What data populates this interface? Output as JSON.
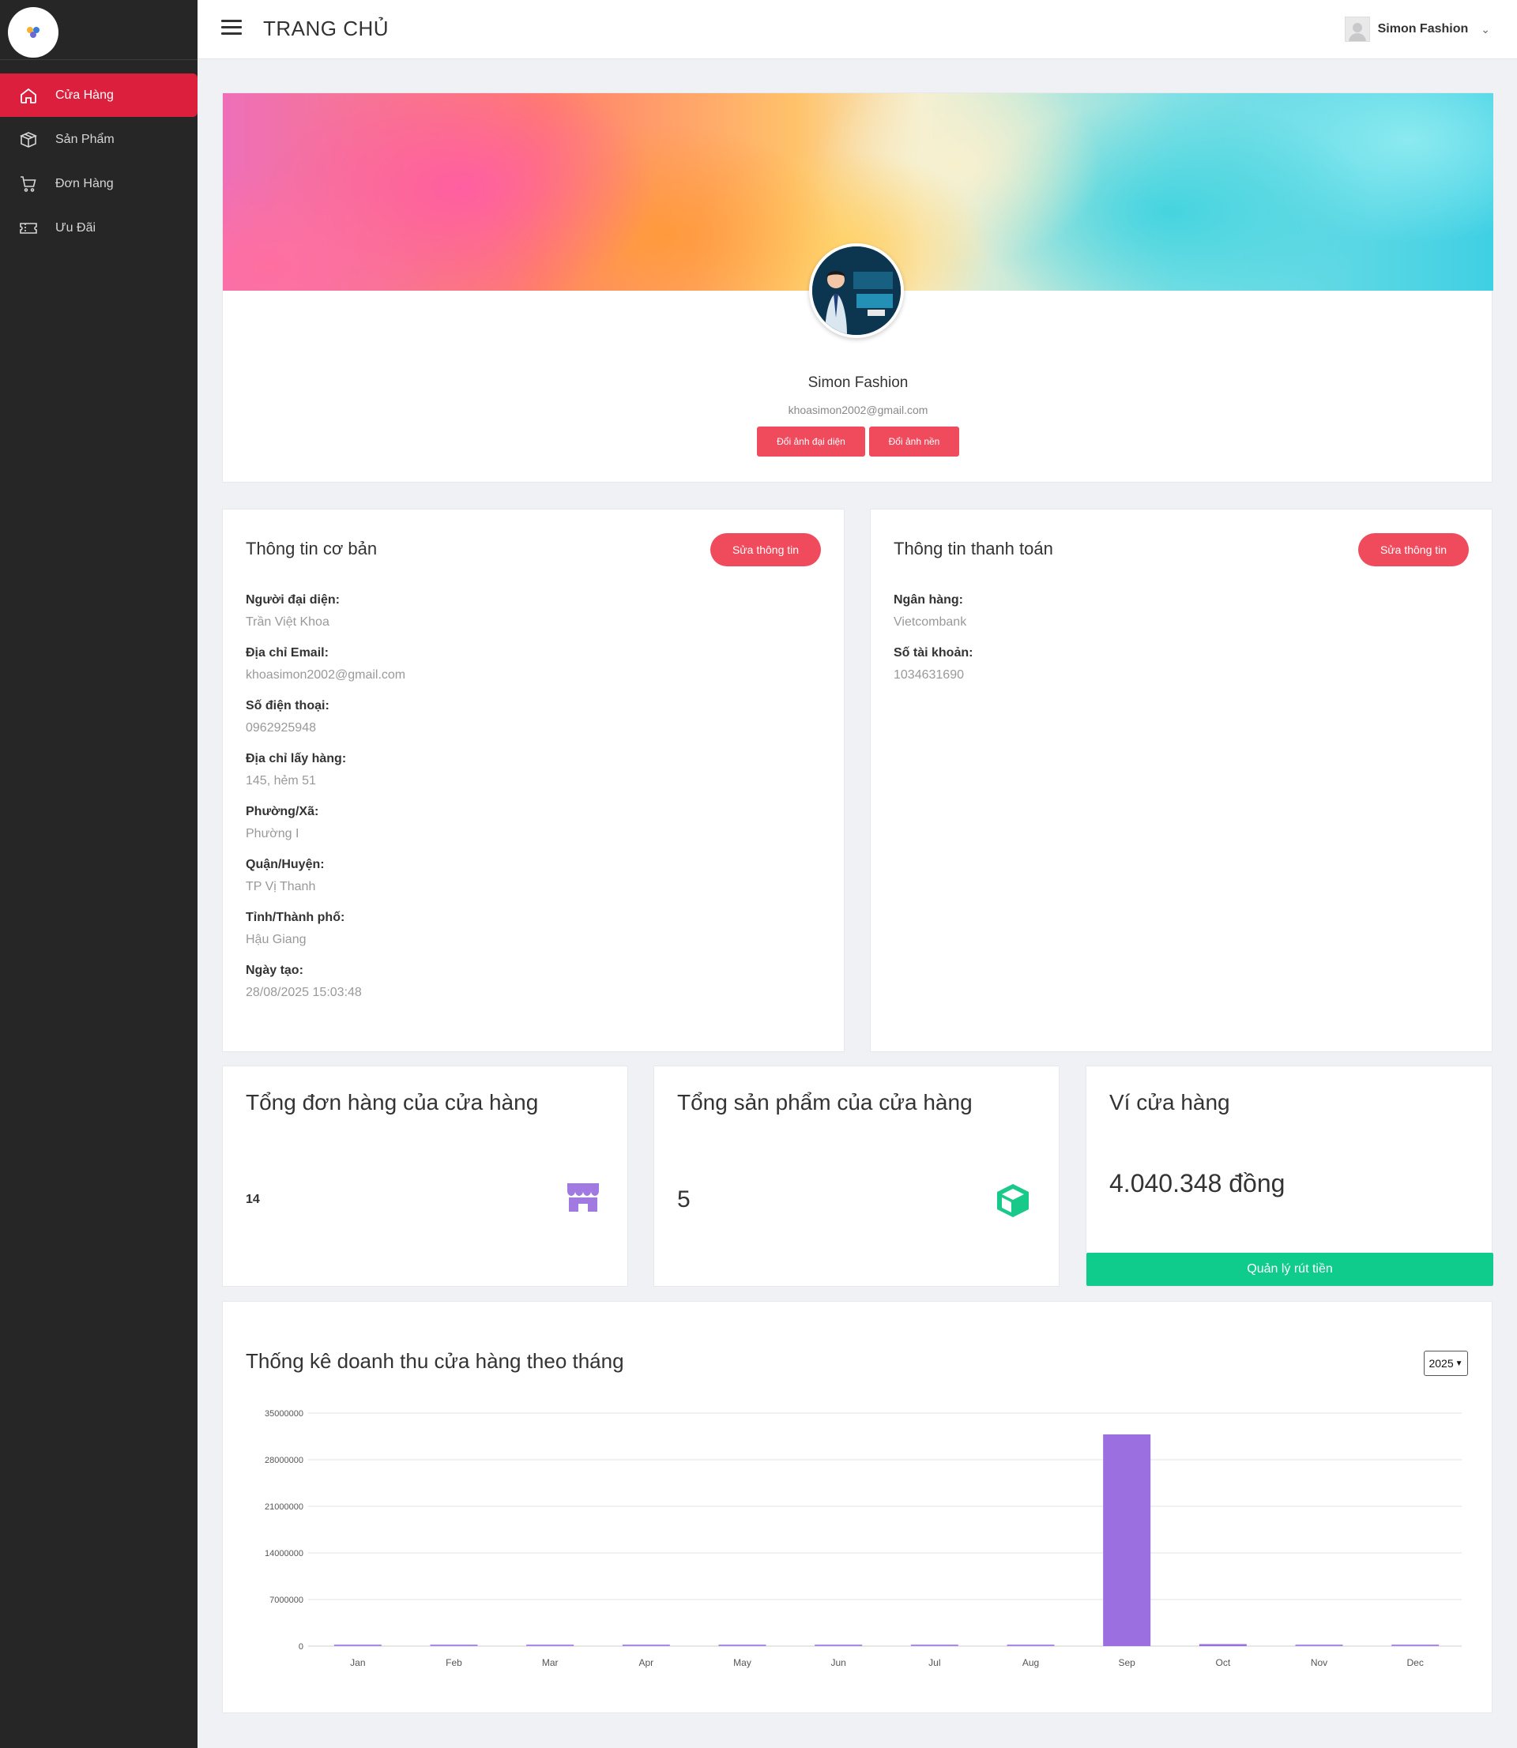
{
  "sidebar": {
    "items": [
      {
        "label": "Cửa Hàng",
        "icon": "home-icon",
        "active": true
      },
      {
        "label": "Sản Phẩm",
        "icon": "box-icon",
        "active": false
      },
      {
        "label": "Đơn Hàng",
        "icon": "cart-icon",
        "active": false
      },
      {
        "label": "Ưu Đãi",
        "icon": "ticket-icon",
        "active": false
      }
    ]
  },
  "header": {
    "title": "TRANG CHỦ",
    "user_name": "Simon Fashion"
  },
  "profile": {
    "name": "Simon Fashion",
    "email": "khoasimon2002@gmail.com",
    "change_avatar_label": "Đổi ảnh đại diện",
    "change_cover_label": "Đổi ảnh nền"
  },
  "basic_info": {
    "title": "Thông tin cơ bản",
    "edit_label": "Sửa thông tin",
    "fields": [
      {
        "label": "Người đại diện:",
        "value": "Trần Việt Khoa"
      },
      {
        "label": "Địa chỉ Email:",
        "value": "khoasimon2002@gmail.com"
      },
      {
        "label": "Số điện thoại:",
        "value": "0962925948"
      },
      {
        "label": "Địa chỉ lấy hàng:",
        "value": "145, hẻm 51"
      },
      {
        "label": "Phường/Xã:",
        "value": "Phường I"
      },
      {
        "label": "Quận/Huyện:",
        "value": "TP Vị Thanh"
      },
      {
        "label": "Tỉnh/Thành phố:",
        "value": "Hậu Giang"
      },
      {
        "label": "Ngày tạo:",
        "value": "28/08/2025 15:03:48"
      }
    ]
  },
  "payment_info": {
    "title": "Thông tin thanh toán",
    "edit_label": "Sửa thông tin",
    "fields": [
      {
        "label": "Ngân hàng:",
        "value": "Vietcombank"
      },
      {
        "label": "Số tài khoản:",
        "value": "1034631690"
      }
    ]
  },
  "stats": {
    "orders": {
      "title": "Tổng đơn hàng của cửa hàng",
      "value": "14",
      "icon": "store-icon"
    },
    "products": {
      "title": "Tổng sản phẩm của cửa hàng",
      "value": "5",
      "icon": "package-icon"
    },
    "wallet": {
      "title": "Ví cửa hàng",
      "value": "4.040.348 đồng",
      "button_label": "Quản lý rút tiền"
    }
  },
  "revenue": {
    "title": "Thống kê doanh thu cửa hàng theo tháng",
    "year": "2025"
  },
  "colors": {
    "accent": "#dc1f3c",
    "button_red": "#f04b5d",
    "green": "#0fcb8c",
    "bar": "#9b6fe0"
  },
  "chart_data": {
    "type": "bar",
    "categories": [
      "Jan",
      "Feb",
      "Mar",
      "Apr",
      "May",
      "Jun",
      "Jul",
      "Aug",
      "Sep",
      "Oct",
      "Nov",
      "Dec"
    ],
    "values": [
      0,
      0,
      0,
      0,
      0,
      0,
      0,
      0,
      31800000,
      300000,
      0,
      0
    ],
    "ylim": [
      0,
      35000000
    ],
    "yticks": [
      0,
      7000000,
      14000000,
      21000000,
      28000000,
      35000000
    ],
    "grid": true
  }
}
